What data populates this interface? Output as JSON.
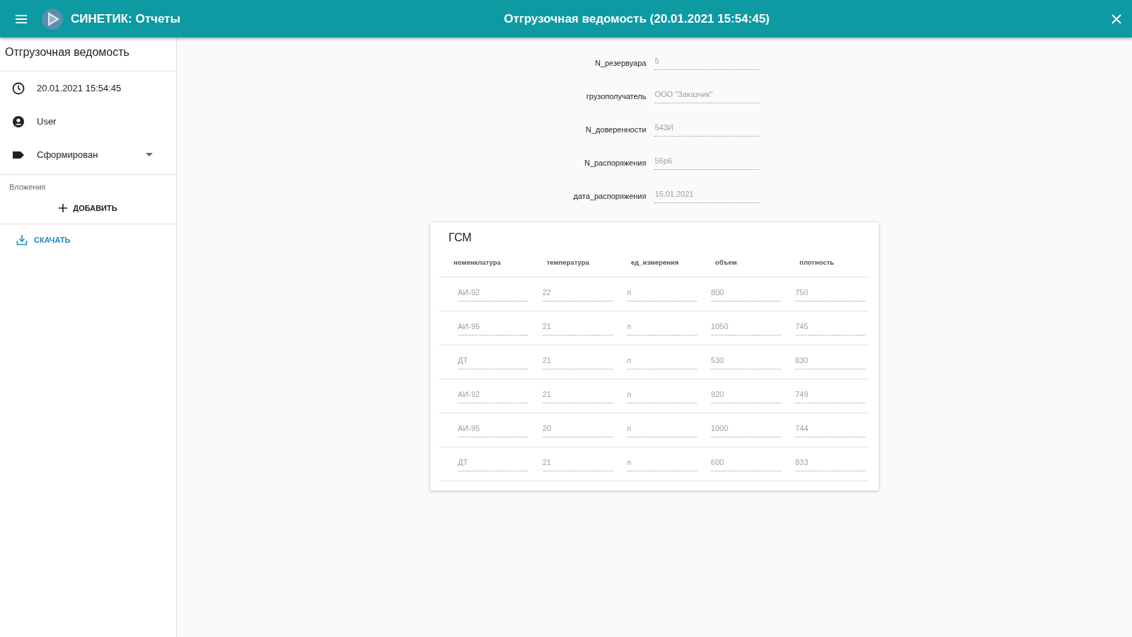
{
  "app_bar": {
    "app_title": "СИНЕТИК: Отчеты",
    "title": "Отгрузочная ведомость (20.01.2021 15:54:45)"
  },
  "sidebar": {
    "title": "Отгрузочная ведомость",
    "date": "20.01.2021 15:54:45",
    "user": "User",
    "status": "Сформирован",
    "attachments_label": "Вложения",
    "add_button": "ДОБАВИТЬ",
    "download_button": "СКАЧАТЬ"
  },
  "fields": [
    {
      "label": "N_резервуара",
      "value": "5"
    },
    {
      "label": "грузополучатель",
      "value": "ООО \"Заказчик\""
    },
    {
      "label": "N_доверенности",
      "value": "543И"
    },
    {
      "label": "N_распоряжения",
      "value": "56р6"
    },
    {
      "label": "дата_распоряжения",
      "value": "15.01.2021"
    }
  ],
  "table": {
    "title": "ГСМ",
    "columns": [
      "номенклатура",
      "температура",
      "ед_измерения",
      "объем",
      "плотность"
    ],
    "rows": [
      [
        "АИ-92",
        "22",
        "л",
        "800",
        "750"
      ],
      [
        "АИ-95",
        "21",
        "л",
        "1050",
        "745"
      ],
      [
        "ДТ",
        "21",
        "л",
        "530",
        "830"
      ],
      [
        "АИ-92",
        "21",
        "л",
        "920",
        "749"
      ],
      [
        "АИ-95",
        "20",
        "л",
        "1000",
        "744"
      ],
      [
        "ДТ",
        "21",
        "л",
        "600",
        "833"
      ]
    ]
  }
}
